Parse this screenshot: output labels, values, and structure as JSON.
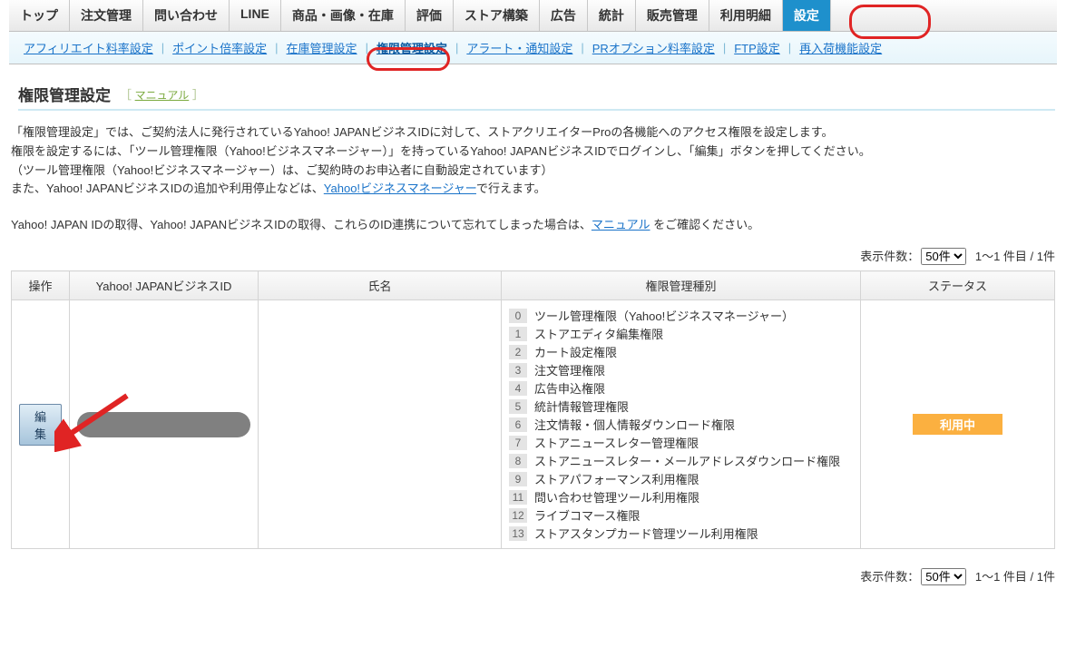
{
  "main_tabs": [
    "トップ",
    "注文管理",
    "問い合わせ",
    "LINE",
    "商品・画像・在庫",
    "評価",
    "ストア構築",
    "広告",
    "統計",
    "販売管理",
    "利用明細",
    "設定"
  ],
  "main_tab_active_index": 11,
  "sub_tabs": [
    "アフィリエイト料率設定",
    "ポイント倍率設定",
    "在庫管理設定",
    "権限管理設定",
    "アラート・通知設定",
    "PRオプション料率設定",
    "FTP設定",
    "再入荷機能設定"
  ],
  "sub_tab_current_index": 3,
  "page_title": "権限管理設定",
  "manual_label": "マニュアル",
  "desc_line1": "「権限管理設定」では、ご契約法人に発行されているYahoo! JAPANビジネスIDに対して、ストアクリエイターProの各機能へのアクセス権限を設定します。",
  "desc_line2": "権限を設定するには、「ツール管理権限（Yahoo!ビジネスマネージャー）」を持っているYahoo! JAPANビジネスIDでログインし、「編集」ボタンを押してください。",
  "desc_line3": "（ツール管理権限（Yahoo!ビジネスマネージャー）は、ご契約時のお申込者に自動設定されています）",
  "desc_line4_pre": "また、Yahoo! JAPANビジネスIDの追加や利用停止などは、",
  "desc_line4_link": "Yahoo!ビジネスマネージャー",
  "desc_line4_post": "で行えます。",
  "desc2_pre": "Yahoo! JAPAN IDの取得、Yahoo! JAPANビジネスIDの取得、これらのID連携について忘れてしまった場合は、",
  "desc2_link": "マニュアル",
  "desc2_post": " をご確認ください。",
  "pager": {
    "label": "表示件数：",
    "selected": "50件",
    "options": [
      "50件"
    ],
    "range": "1〜1 件目 /  1件"
  },
  "table": {
    "headers": [
      "操作",
      "Yahoo! JAPANビジネスID",
      "氏名",
      "権限管理種別",
      "ステータス"
    ],
    "edit_label": "編集",
    "permissions": [
      {
        "n": "0",
        "t": "ツール管理権限（Yahoo!ビジネスマネージャー）"
      },
      {
        "n": "1",
        "t": "ストアエディタ編集権限"
      },
      {
        "n": "2",
        "t": "カート設定権限"
      },
      {
        "n": "3",
        "t": "注文管理権限"
      },
      {
        "n": "4",
        "t": "広告申込権限"
      },
      {
        "n": "5",
        "t": "統計情報管理権限"
      },
      {
        "n": "6",
        "t": "注文情報・個人情報ダウンロード権限"
      },
      {
        "n": "7",
        "t": "ストアニュースレター管理権限"
      },
      {
        "n": "8",
        "t": "ストアニュースレター・メールアドレスダウンロード権限"
      },
      {
        "n": "9",
        "t": "ストアパフォーマンス利用権限"
      },
      {
        "n": "11",
        "t": "問い合わせ管理ツール利用権限"
      },
      {
        "n": "12",
        "t": "ライブコマース権限"
      },
      {
        "n": "13",
        "t": "ストアスタンプカード管理ツール利用権限"
      }
    ],
    "status": "利用中"
  }
}
